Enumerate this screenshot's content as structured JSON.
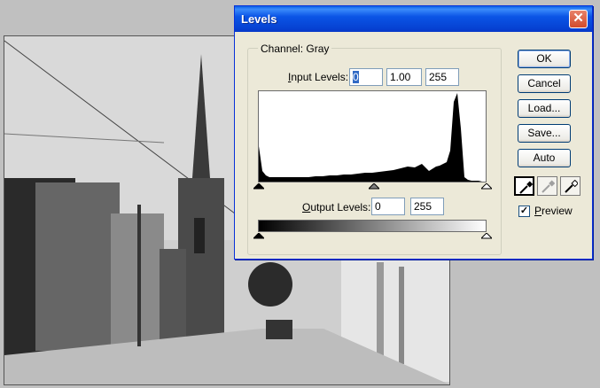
{
  "dialog": {
    "title": "Levels",
    "close_glyph": "✕",
    "channel_label": "Channel: Gray",
    "input_levels": {
      "label_prefix": "I",
      "label_rest": "nput Levels:",
      "black": "0",
      "gamma": "1.00",
      "white": "255"
    },
    "output_levels": {
      "label_prefix": "O",
      "label_rest": "utput Levels:",
      "black": "0",
      "white": "255"
    },
    "buttons": {
      "ok": "OK",
      "cancel": "Cancel",
      "load": "Load...",
      "save": "Save...",
      "auto": "Auto"
    },
    "preview": {
      "checked_glyph": "✓",
      "label_prefix": "P",
      "label_rest": "review",
      "checked": true
    },
    "icons": {
      "close": "close-icon",
      "black_eyedropper": "black-eyedropper-icon",
      "gray_eyedropper": "gray-eyedropper-icon",
      "white_eyedropper": "white-eyedropper-icon"
    }
  },
  "histogram": {
    "levels": [
      0,
      4,
      8,
      12,
      16,
      20,
      24,
      28,
      32,
      40,
      48,
      56,
      64,
      72,
      80,
      88,
      96,
      104,
      112,
      120,
      128,
      136,
      144,
      152,
      160,
      168,
      176,
      184,
      192,
      200,
      204,
      208,
      212,
      216,
      220,
      224,
      228,
      232,
      236,
      240,
      244,
      248,
      252,
      255
    ],
    "counts": [
      0.4,
      0.12,
      0.07,
      0.05,
      0.05,
      0.05,
      0.05,
      0.05,
      0.05,
      0.05,
      0.05,
      0.05,
      0.06,
      0.06,
      0.07,
      0.07,
      0.08,
      0.08,
      0.09,
      0.1,
      0.1,
      0.11,
      0.12,
      0.13,
      0.15,
      0.17,
      0.16,
      0.2,
      0.12,
      0.17,
      0.18,
      0.2,
      0.22,
      0.35,
      0.9,
      1.0,
      0.6,
      0.05,
      0.02,
      0.01,
      0.01,
      0.01,
      0.0,
      0.0
    ]
  }
}
